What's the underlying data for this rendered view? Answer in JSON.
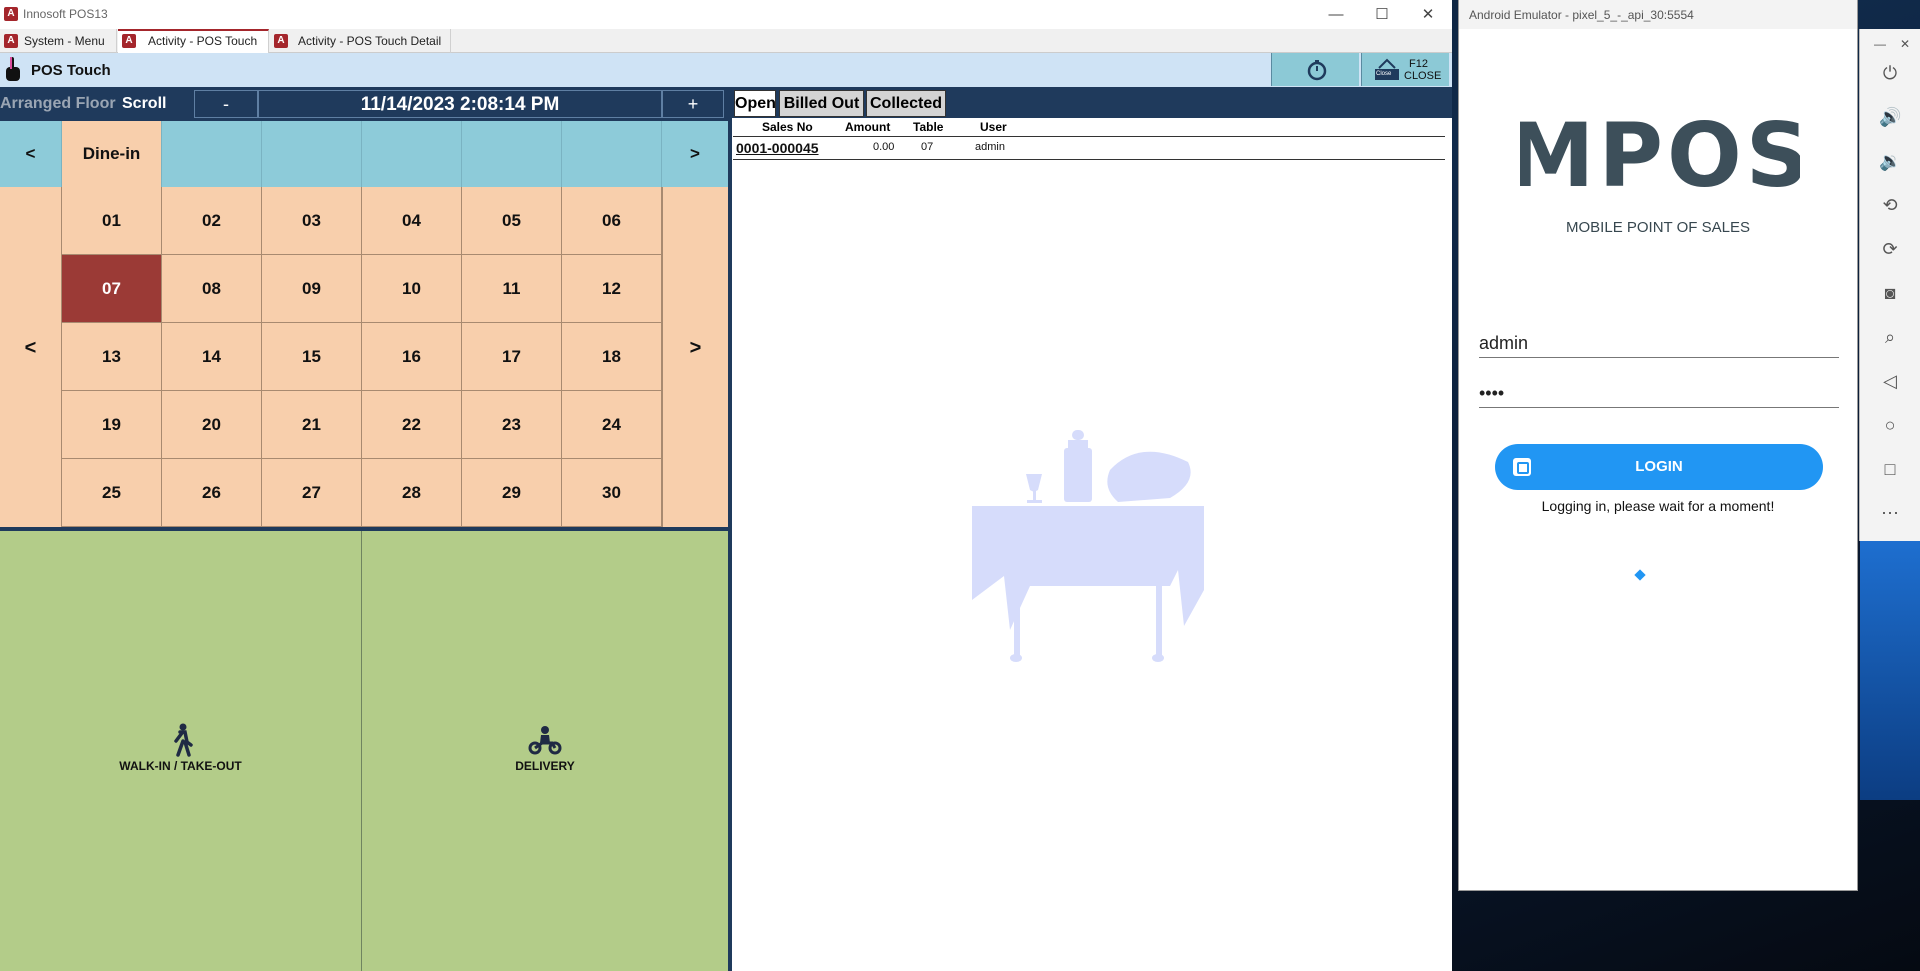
{
  "app": {
    "title": "Innosoft POS13",
    "icon": "access-app-icon"
  },
  "doc_tabs": [
    {
      "label": "System - Menu"
    },
    {
      "label": "Activity - POS Touch"
    },
    {
      "label": "Activity - POS Touch Detail"
    }
  ],
  "window_controls": {
    "minimize": "—",
    "maximize": "☐",
    "close": "✕"
  },
  "form": {
    "title": "POS Touch",
    "close_key": "F12",
    "close_label": "CLOSE",
    "close_small": "Close"
  },
  "floor": {
    "label": "Arranged Floor",
    "scroll_label": "Scroll",
    "minus": "-",
    "datetime": "11/14/2023 2:08:14 PM",
    "plus": "+"
  },
  "areas": {
    "prev": "<",
    "next": ">",
    "items": [
      "Dine-in",
      "",
      "",
      "",
      "",
      ""
    ]
  },
  "tables": {
    "prev": "<",
    "next": ">",
    "selected": "07",
    "rows": [
      [
        "01",
        "02",
        "03",
        "04",
        "05",
        "06"
      ],
      [
        "07",
        "08",
        "09",
        "10",
        "11",
        "12"
      ],
      [
        "13",
        "14",
        "15",
        "16",
        "17",
        "18"
      ],
      [
        "19",
        "20",
        "21",
        "22",
        "23",
        "24"
      ],
      [
        "25",
        "26",
        "27",
        "28",
        "29",
        "30"
      ]
    ]
  },
  "order_types": {
    "walkin": "WALK-IN / TAKE-OUT",
    "delivery": "DELIVERY"
  },
  "orders": {
    "tabs": [
      "Open",
      "Billed Out",
      "Collected"
    ],
    "active_tab": "Open",
    "columns": [
      "Sales No",
      "Amount",
      "Table",
      "User"
    ],
    "rows": [
      {
        "sales_no": "0001-000045",
        "amount": "0.00",
        "table": "07",
        "user": "admin"
      }
    ]
  },
  "emulator": {
    "title": "Android Emulator - pixel_5_-_api_30:5554",
    "logo": "MPOS",
    "tagline": "MOBILE POINT OF SALES",
    "username": "admin",
    "password": "••••",
    "login_label": "LOGIN",
    "wait_message": "Logging in, please wait for a moment!",
    "side_icons": [
      "power-icon",
      "volume-up-icon",
      "volume-down-icon",
      "rotate-left-icon",
      "rotate-right-icon",
      "camera-icon",
      "zoom-icon",
      "back-icon",
      "home-icon",
      "overview-icon",
      "more-icon"
    ],
    "top_controls": {
      "minimize": "—",
      "close": "✕"
    }
  },
  "colors": {
    "navy": "#1f3a5c",
    "peach": "#f8cfac",
    "selected_table": "#9b3a36",
    "teal": "#8dcbd9",
    "green": "#b3cc89",
    "login_blue": "#2196f3"
  }
}
